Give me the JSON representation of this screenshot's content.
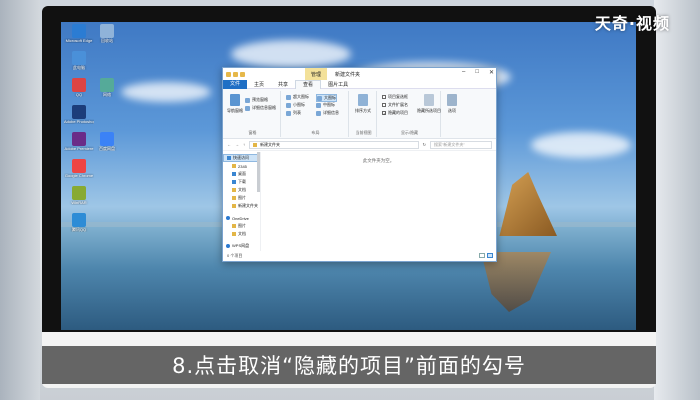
{
  "logo": "天奇·视频",
  "caption": "8.点击取消“隐藏的项目”前面的勾号",
  "desktop_icons": [
    {
      "label": "Microsoft Edge",
      "color": "#2b7cd3"
    },
    {
      "label": "回收站",
      "color": "#8fb3d9"
    },
    {
      "label": "此电脑",
      "color": "#4a90d9"
    },
    {
      "label": "QQ",
      "color": "#d44"
    },
    {
      "label": "网络",
      "color": "#5a9"
    },
    {
      "label": "Adobe Photoshop",
      "color": "#1c3d7a"
    },
    {
      "label": "Adobe Premiere",
      "color": "#6a2b88"
    },
    {
      "label": "百度网盘",
      "color": "#3b82f6"
    },
    {
      "label": "Google Chrome",
      "color": "#e44"
    },
    {
      "label": "WinRAR",
      "color": "#8a3"
    },
    {
      "label": "腾讯QQ",
      "color": "#2d8cd6"
    }
  ],
  "window": {
    "title": "新建文件夹",
    "manage_tab": "管理",
    "tabs": [
      "文件",
      "主页",
      "共享",
      "查看",
      "图片工具"
    ],
    "ribbon": {
      "pane_group": {
        "label": "窗格",
        "items": [
          "导航窗格",
          "预览窗格",
          "详细信息窗格"
        ]
      },
      "layout_group": {
        "label": "布局",
        "items": [
          "超大图标",
          "大图标",
          "中图标",
          "小图标",
          "列表",
          "详细信息"
        ]
      },
      "current_view_group": {
        "label": "当前视图",
        "items": [
          "排序方式"
        ]
      },
      "show_hide_group": {
        "label": "显示/隐藏",
        "items": [
          "项目复选框",
          "文件扩展名",
          "隐藏的项目"
        ],
        "hide_selected": "隐藏所选项目"
      },
      "options": "选项"
    },
    "address": "新建文件夹",
    "search_placeholder": "搜索\"新建文件夹\"",
    "nav": [
      {
        "label": "快速访问",
        "type": "blue",
        "sub": false,
        "selected": true
      },
      {
        "label": "2345",
        "type": "folder",
        "sub": true
      },
      {
        "label": "桌面",
        "type": "blue",
        "sub": true
      },
      {
        "label": "下载",
        "type": "blue",
        "sub": true
      },
      {
        "label": "文档",
        "type": "folder",
        "sub": true
      },
      {
        "label": "图片",
        "type": "folder",
        "sub": true
      },
      {
        "label": "新建文件夹",
        "type": "folder",
        "sub": true
      },
      {
        "label": "OneDrive",
        "type": "cloud",
        "sub": false
      },
      {
        "label": "图片",
        "type": "folder",
        "sub": true
      },
      {
        "label": "文档",
        "type": "folder",
        "sub": true
      },
      {
        "label": "WPS网盘",
        "type": "cloud",
        "sub": false
      }
    ],
    "empty_text": "此文件夹为空。",
    "status": "0 个项目"
  },
  "colors": {
    "accent": "#1f6fc5",
    "manage": "#f3e19a"
  }
}
